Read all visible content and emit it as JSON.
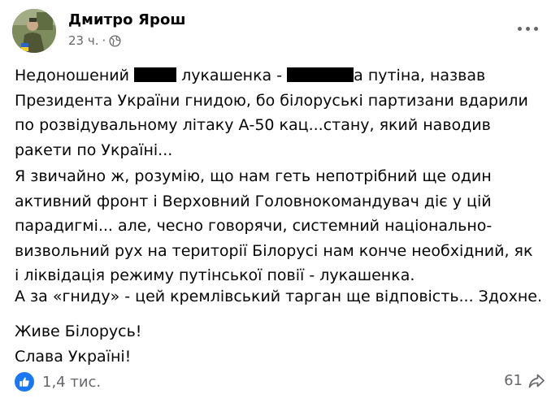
{
  "post": {
    "author": "Дмитро Ярош",
    "time": "23 ч.",
    "separator": "·",
    "privacy_icon": "globe-icon",
    "menu_icon": "more-options-icon",
    "paragraph1": {
      "part1": "Недоношений ",
      "part2": " лукашенка - ",
      "part3": "а путіна, назвав Президента України гнидою, бо білоруські партизани вдарили по розвідувальному літаку А-50 кац...стану, який наводив ракети по Україні..."
    },
    "paragraph2": "Я звичайно ж, розумію, що нам геть непотрібний ще один активний фронт і Верховний Головнокомандувач діє у цій парадигмі... але, чесно говорячи, системний національно-визвольний рух на території Білорусі нам конче необхідний, як і ліквідація режиму путінської повії - лукашенка.",
    "paragraph3": "А за «гниду» - цей кремлівський тарган ще відповість... Здохне.",
    "closing_line1": "Живе Білорусь!",
    "closing_line2": "Слава Україні!"
  },
  "footer": {
    "reaction_icon": "like-icon",
    "reaction_count": "1,4 тис.",
    "share_count": "61",
    "share_icon": "share-arrow-icon"
  },
  "colors": {
    "text": "#050505",
    "secondary_text": "#65676b",
    "like_blue": "#1877f2",
    "redaction": "#000000"
  }
}
